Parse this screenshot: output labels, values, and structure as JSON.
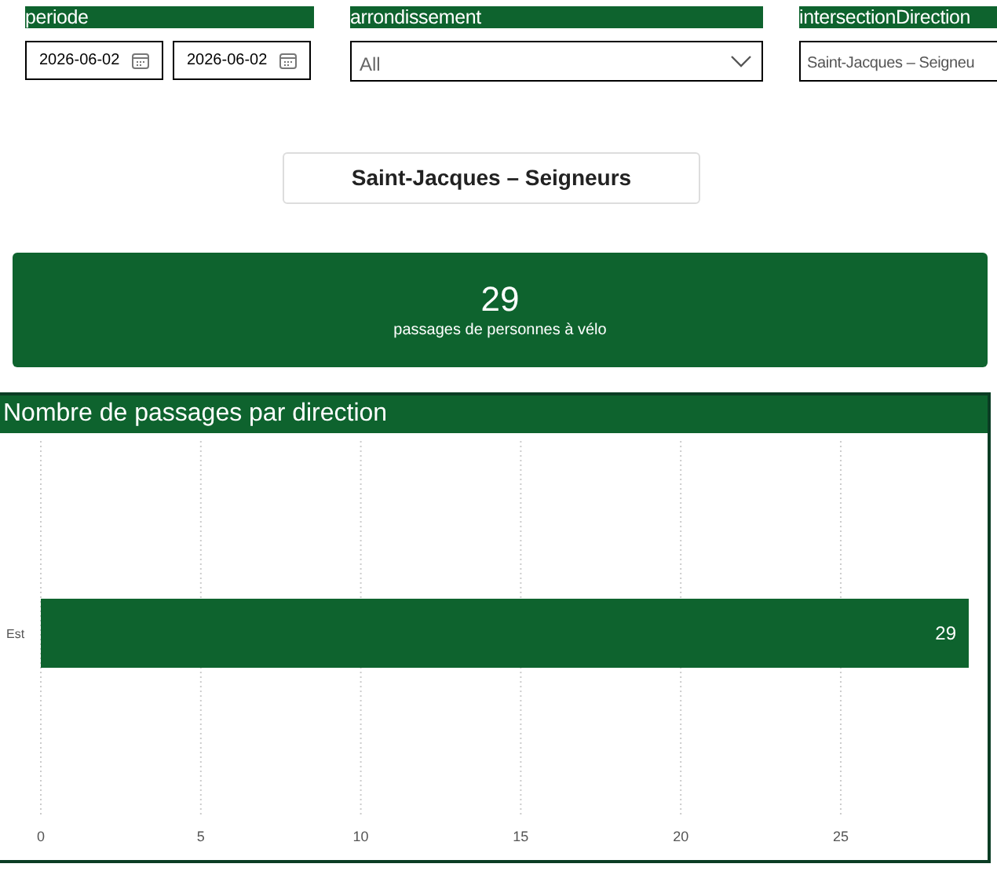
{
  "filters": [
    {
      "label": "periode",
      "kind": "dates",
      "values": [
        "2026-06-02",
        "2026-06-02"
      ]
    },
    {
      "label": "arrondissement",
      "kind": "dropdown",
      "placeholder": "All"
    },
    {
      "label": "intersectionDirection",
      "kind": "text",
      "value": "Saint-Jacques – Seigneu"
    }
  ],
  "title": "Saint-Jacques – Seigneurs",
  "kpi": {
    "value": "29",
    "caption": "passages de personnes à vélo"
  },
  "chart": {
    "title": "Nombre de passages par direction",
    "chart_data": {
      "type": "bar",
      "orientation": "horizontal",
      "categories": [
        "Est"
      ],
      "series": [
        {
          "color": "#0e632e",
          "values": [
            29
          ]
        }
      ],
      "xlim": [
        0,
        29
      ],
      "xticks": [
        0,
        5,
        10,
        15,
        20,
        25
      ],
      "grid": true,
      "data_labels": true
    }
  }
}
